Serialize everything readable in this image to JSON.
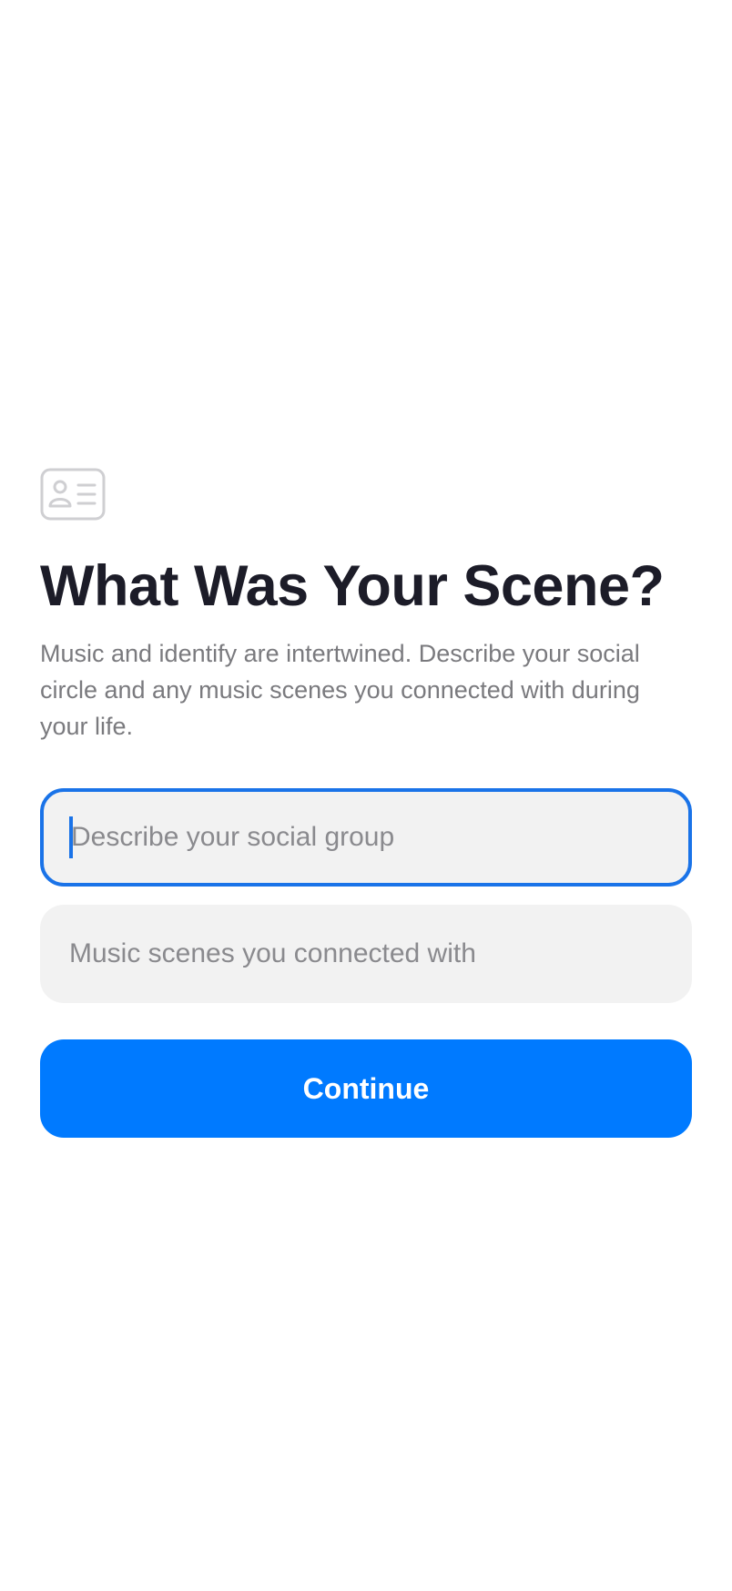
{
  "header": {
    "icon": "id-card-icon",
    "title": "What Was Your Scene?",
    "subtitle": "Music and identify are intertwined. Describe your social circle and any music scenes you connected with during your life."
  },
  "form": {
    "social_group": {
      "value": "",
      "placeholder": "Describe your social group",
      "focused": true
    },
    "music_scenes": {
      "value": "",
      "placeholder": "Music scenes you connected with"
    }
  },
  "actions": {
    "continue_label": "Continue"
  },
  "colors": {
    "accent": "#007aff",
    "focus_border": "#1a73e8",
    "title": "#1c1c28",
    "subtitle": "#7a7a7e",
    "field_bg": "#f2f2f2"
  }
}
